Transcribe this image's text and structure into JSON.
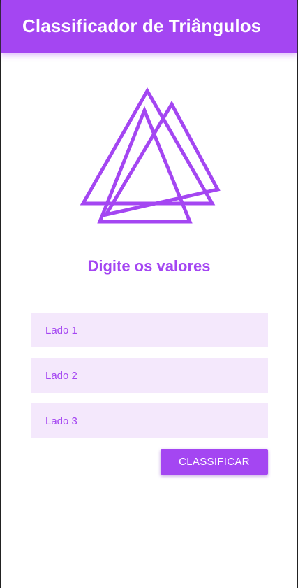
{
  "app_bar": {
    "title": "Classificador de Triângulos"
  },
  "logo": {
    "icon": "triangles-logo-icon"
  },
  "form": {
    "heading": "Digite os valores",
    "fields": [
      {
        "placeholder": "Lado 1",
        "value": ""
      },
      {
        "placeholder": "Lado 2",
        "value": ""
      },
      {
        "placeholder": "Lado 3",
        "value": ""
      }
    ],
    "submit_label": "CLASSIFICAR"
  },
  "colors": {
    "primary": "#a446f2",
    "field_background": "#f4e8fc",
    "on_primary": "#ffffff"
  }
}
